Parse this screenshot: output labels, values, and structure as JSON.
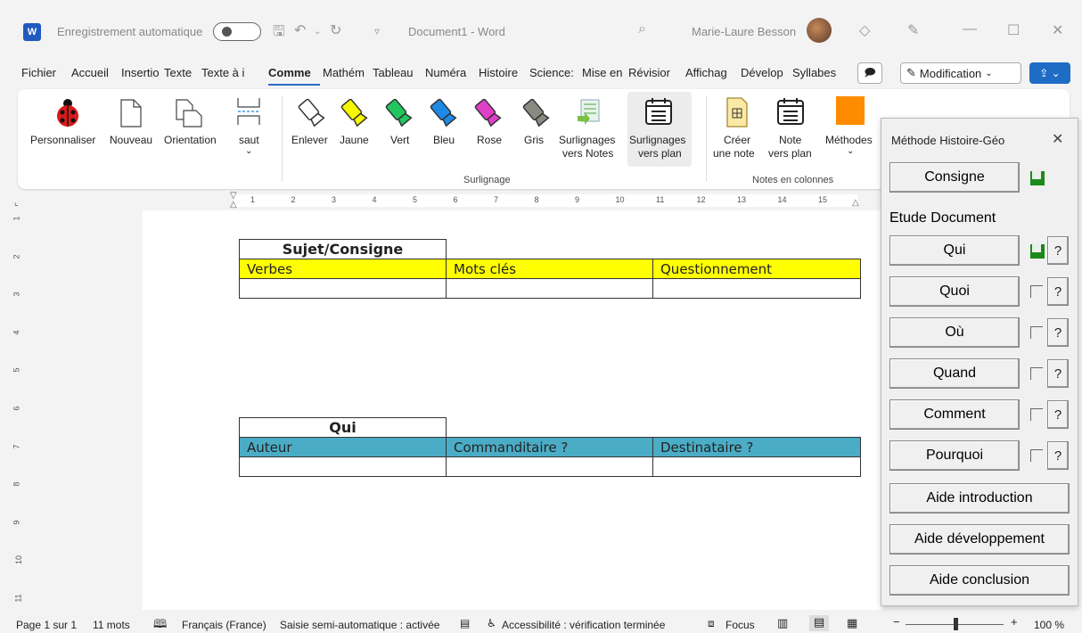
{
  "titlebar": {
    "autosave_label": "Enregistrement automatique",
    "doc_title": "Document1 - Word",
    "username": "Marie-Laure Besson",
    "app_logo": "W"
  },
  "menu": {
    "items": [
      "Fichier",
      "Accueil",
      "Insertion",
      "Texte",
      "Texte à i",
      "Comme",
      "Mathém",
      "Tableau",
      "Numéra",
      "Histoire",
      "Science:",
      "Mise en",
      "Révisior",
      "Affichag",
      "Dévelop",
      "Syllabes"
    ],
    "modification_label": "Modification"
  },
  "ribbon": {
    "personnaliser": "Personnaliser",
    "nouveau": "Nouveau",
    "orientation": "Orientation",
    "saut": "saut",
    "enlever": "Enlever",
    "jaune": "Jaune",
    "vert": "Vert",
    "bleu": "Bleu",
    "rose": "Rose",
    "gris": "Gris",
    "surl_notes_1": "Surlignages",
    "surl_notes_2": "vers Notes",
    "surl_plan_1": "Surlignages",
    "surl_plan_2": "vers plan",
    "creer_1": "Créer",
    "creer_2": "une note",
    "note_plan_1": "Note",
    "note_plan_2": "vers plan",
    "methodes": "Méthodes",
    "group_surlignage": "Surlignage",
    "group_notes": "Notes en colonnes"
  },
  "colors": {
    "jaune": "#f7f700",
    "vert": "#22c55e",
    "bleu": "#1e88e5",
    "rose": "#e040c8",
    "gris": "#8a8a80",
    "table1_fill": "#ffff00",
    "table2_fill": "#4bacc6",
    "methodes_square": "#ff8c00"
  },
  "ruler": {
    "h_ticks": [
      "1",
      "2",
      "3",
      "4",
      "5",
      "6",
      "7",
      "8",
      "9",
      "10",
      "11",
      "12",
      "13",
      "14",
      "15"
    ],
    "v_ticks": [
      "1",
      "2",
      "3",
      "4",
      "5",
      "6",
      "7",
      "8",
      "9",
      "10",
      "11"
    ]
  },
  "document": {
    "table1": {
      "header": "Sujet/Consigne",
      "columns": [
        "Verbes",
        "Mots clés",
        "Questionnement"
      ]
    },
    "table2": {
      "header": "Qui",
      "columns": [
        "Auteur",
        "Commanditaire ?",
        "Destinataire ?"
      ]
    }
  },
  "panel": {
    "title": "Méthode Histoire-Géo",
    "consigne": "Consigne",
    "etude": "Etude Document",
    "rows": [
      "Qui",
      "Quoi",
      "Où",
      "Quand",
      "Comment",
      "Pourquoi"
    ],
    "question_mark": "?",
    "aide_intro": "Aide introduction",
    "aide_dev": "Aide développement",
    "aide_conc": "Aide conclusion"
  },
  "statusbar": {
    "page": "Page 1 sur 1",
    "words": "11 mots",
    "language": "Français (France)",
    "input_mode": "Saisie semi-automatique : activée",
    "accessibility": "Accessibilité : vérification terminée",
    "focus": "Focus",
    "zoom": "100 %"
  }
}
